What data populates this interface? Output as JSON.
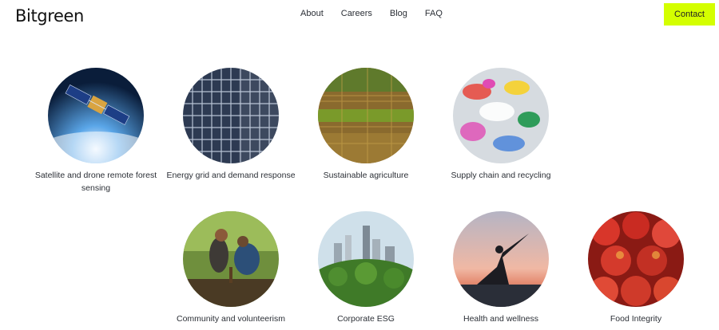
{
  "header": {
    "logo": "Bitgreen",
    "nav": [
      "About",
      "Careers",
      "Blog",
      "FAQ"
    ],
    "contact_label": "Contact",
    "accent_color": "#d4ff00"
  },
  "use_cases": [
    {
      "label": "Satellite and drone remote forest sensing",
      "icon": "satellite-image"
    },
    {
      "label": "Energy grid and demand response",
      "icon": "solar-panel-image"
    },
    {
      "label": "Sustainable agriculture",
      "icon": "farmland-image"
    },
    {
      "label": "Supply chain and recycling",
      "icon": "plastic-waste-image"
    },
    {
      "label": "Community and volunteerism",
      "icon": "tree-planting-image"
    },
    {
      "label": "Corporate ESG",
      "icon": "city-park-image"
    },
    {
      "label": "Health and wellness",
      "icon": "yoga-image"
    },
    {
      "label": "Food Integrity",
      "icon": "apples-image"
    }
  ]
}
